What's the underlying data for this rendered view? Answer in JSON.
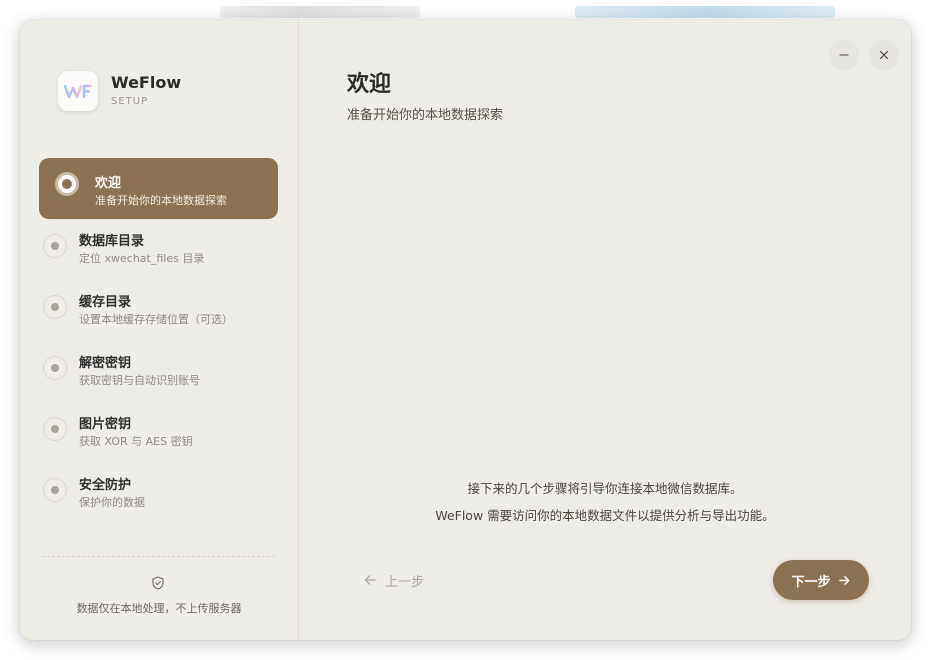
{
  "app": {
    "name": "WeFlow",
    "subtitle": "SETUP"
  },
  "steps": [
    {
      "title": "欢迎",
      "desc": "准备开始你的本地数据探索",
      "active": true
    },
    {
      "title": "数据库目录",
      "desc": "定位 xwechat_files 目录",
      "active": false
    },
    {
      "title": "缓存目录",
      "desc": "设置本地缓存存储位置（可选）",
      "active": false
    },
    {
      "title": "解密密钥",
      "desc": "获取密钥与自动识别账号",
      "active": false
    },
    {
      "title": "图片密钥",
      "desc": "获取 XOR 与 AES 密钥",
      "active": false
    },
    {
      "title": "安全防护",
      "desc": "保护你的数据",
      "active": false
    }
  ],
  "sidebar": {
    "privacy_note": "数据仅在本地处理，不上传服务器"
  },
  "main": {
    "title": "欢迎",
    "subtitle": "准备开始你的本地数据探索",
    "intro_line1": "接下来的几个步骤将引导你连接本地微信数据库。",
    "intro_line2": "WeFlow 需要访问你的本地数据文件以提供分析与导出功能。",
    "prev_label": "上一步",
    "next_label": "下一步"
  },
  "colors": {
    "accent": "#8b7253",
    "background": "#efede8"
  }
}
